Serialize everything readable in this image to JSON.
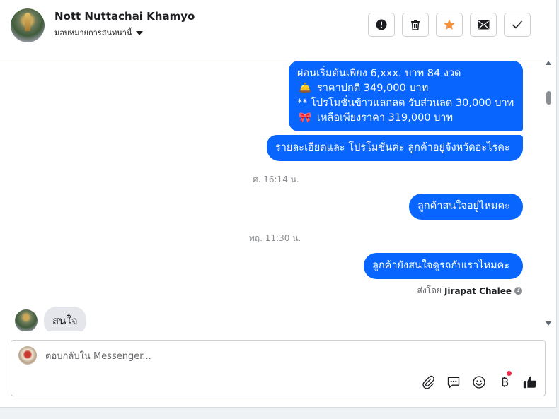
{
  "header": {
    "contact_name": "Nott Nuttachai Khamyo",
    "assign_label": "มอบหมายการสนทนานี้",
    "actions": [
      "alert-icon",
      "trash-icon",
      "star-icon",
      "envelope-icon",
      "check-icon"
    ],
    "star_color": "#f7923a"
  },
  "messages": {
    "m1_line1": "ผ่อนเริ่มต้นเพียง 6,xxx. บาท 84 งวด",
    "m1_line2_emoji": "🛎️",
    "m1_line2": "ราคาปกติ 349,000 บาท",
    "m1_line3": "** โปรโมชั่นข้าวแลกลด รับส่วนลด 30,000 บาท",
    "m1_line4_emoji": "🎀",
    "m1_line4": "เหลือเพียงราคา 319,000 บาท",
    "m2": "รายละเอียดและ โปรโมชั่นค่ะ ลูกค้าอยู่จังหวัดอะไรคะ",
    "ts1": "ศ. 16:14 น.",
    "m3": "ลูกค้าสนใจอยู่ไหมคะ",
    "ts2": "พฤ. 11:30 น.",
    "m4": "ลูกค้ายังสนใจดูรถกับเราไหมคะ",
    "sent_by_prefix": "ส่งโดย",
    "sent_by_name": "Jirapat Chalee",
    "incoming": "สนใจ"
  },
  "composer": {
    "placeholder": "ตอบกลับใน Messenger...",
    "tools": [
      "attach-icon",
      "saved-reply-icon",
      "emoji-icon",
      "baht-payment-icon",
      "like-icon"
    ]
  },
  "colors": {
    "outgoing_bubble": "#0866ff",
    "incoming_bubble": "#e4e6eb",
    "badge_dot": "#f02849"
  }
}
